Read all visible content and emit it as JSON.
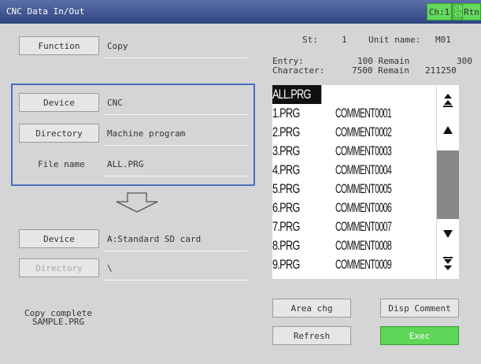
{
  "header": {
    "title": "CNC Data In/Out",
    "ch": "Ch:1",
    "chg_top": "CNC",
    "chg_bottom": "Chg",
    "rtn": "Rtn"
  },
  "function": {
    "label": "Function",
    "value": "Copy"
  },
  "source": {
    "device_label": "Device",
    "device_value": "CNC",
    "directory_label": "Directory",
    "directory_value": "Machine program",
    "filename_label": "File name",
    "filename_value": "ALL.PRG"
  },
  "dest": {
    "device_label": "Device",
    "device_value": "A:Standard SD card",
    "directory_label": "Directory",
    "directory_value": "\\"
  },
  "status": {
    "line1": "Copy complete",
    "line2": "SAMPLE.PRG"
  },
  "info": {
    "st_label": "St:",
    "st_value": "1",
    "unit_label": "Unit name:",
    "unit_value": "M01",
    "entry_label": "Entry:",
    "entry_value": "100 Remain",
    "entry_remain": "300",
    "char_label": "Character:",
    "char_value": "7500 Remain",
    "char_remain": "211250"
  },
  "files": [
    {
      "name": "ALL.PRG",
      "comment": ""
    },
    {
      "name": "1.PRG",
      "comment": "COMMENT0001"
    },
    {
      "name": "2.PRG",
      "comment": "COMMENT0002"
    },
    {
      "name": "3.PRG",
      "comment": "COMMENT0003"
    },
    {
      "name": "4.PRG",
      "comment": "COMMENT0004"
    },
    {
      "name": "5.PRG",
      "comment": "COMMENT0005"
    },
    {
      "name": "6.PRG",
      "comment": "COMMENT0006"
    },
    {
      "name": "7.PRG",
      "comment": "COMMENT0007"
    },
    {
      "name": "8.PRG",
      "comment": "COMMENT0008"
    },
    {
      "name": "9.PRG",
      "comment": "COMMENT0009"
    }
  ],
  "buttons": {
    "area_chg": "Area chg",
    "disp_comment": "Disp Comment",
    "refresh": "Refresh",
    "exec": "Exec"
  },
  "icons": {
    "scroll_top": "double-up-arrow-icon",
    "scroll_up": "up-arrow-icon",
    "scroll_down": "down-arrow-icon",
    "scroll_bottom": "double-down-arrow-icon",
    "transfer": "down-arrow-outline-icon"
  },
  "colors": {
    "title_bar": "#3a4f8c",
    "exec": "#5fd658",
    "source_frame": "#4a6fbf",
    "ch_buttons": "#62d85c"
  }
}
